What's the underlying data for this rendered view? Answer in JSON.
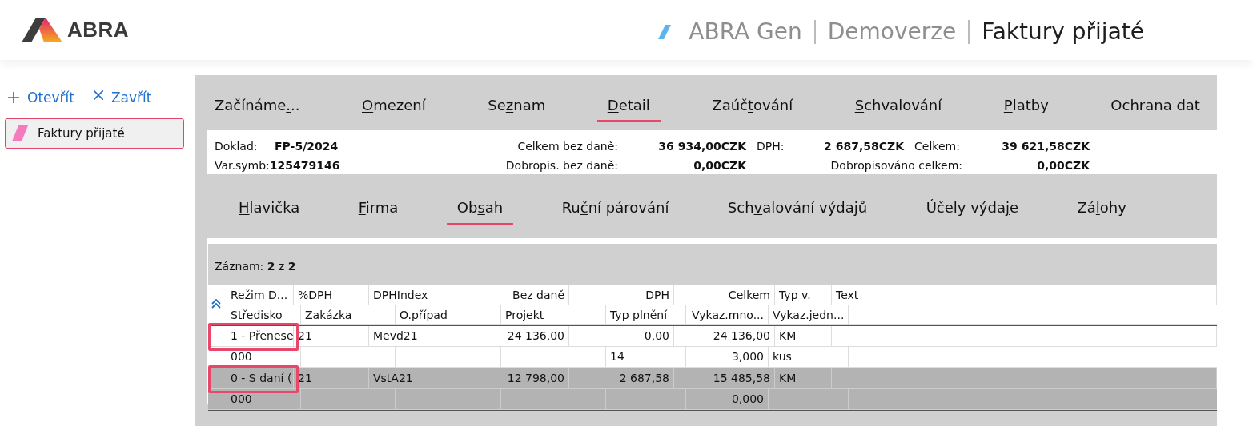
{
  "header": {
    "logo_text": "ABRA",
    "breadcrumb": [
      "ABRA Gen",
      "Demoverze",
      "Faktury přijaté"
    ]
  },
  "sidebar": {
    "actions": [
      {
        "kind": "open",
        "label": "Otevřít"
      },
      {
        "kind": "close",
        "label": "Zavřít"
      }
    ],
    "items": [
      {
        "label": "Faktury přijaté",
        "selected": true
      }
    ]
  },
  "tabs": [
    {
      "label": {
        "before": "Začínáme",
        "key": ".",
        "after": ".."
      },
      "selected": false
    },
    {
      "label": {
        "key": "O",
        "after": "mezení"
      },
      "selected": false
    },
    {
      "label": {
        "before": "Se",
        "key": "z",
        "after": "nam"
      },
      "selected": false
    },
    {
      "label": {
        "key": "D",
        "after": "etail"
      },
      "selected": true
    },
    {
      "label": {
        "before": "Zaúč",
        "key": "t",
        "after": "ování"
      },
      "selected": false
    },
    {
      "label": {
        "key": "S",
        "after": "chvalování"
      },
      "selected": false
    },
    {
      "label": {
        "key": "P",
        "after": "latby"
      },
      "selected": false
    },
    {
      "label": {
        "before": "Ochrana dat"
      },
      "selected": false
    }
  ],
  "summary": [
    {
      "label": "Doklad:",
      "value": "FP-5/2024"
    },
    {
      "label": "Celkem bez daně:",
      "value": "36 934,00CZK"
    },
    {
      "label": "DPH:",
      "value": "2 687,58CZK"
    },
    {
      "label": "Celkem:",
      "value": "39 621,58CZK"
    },
    {
      "label": "Var.symb:",
      "value": "125479146"
    },
    {
      "label": "Dobropis. bez daně:",
      "value": "0,00CZK"
    },
    {
      "label": "Dobropisováno celkem:",
      "value": "0,00CZK"
    }
  ],
  "subtabs": [
    {
      "label": {
        "key": "H",
        "after": "lavička"
      },
      "selected": false
    },
    {
      "label": {
        "key": "F",
        "after": "irma"
      },
      "selected": false
    },
    {
      "label": {
        "before": "Ob",
        "key": "s",
        "after": "ah"
      },
      "selected": true
    },
    {
      "label": {
        "before": "Ru",
        "key": "č",
        "after": "ní párování"
      },
      "selected": false
    },
    {
      "label": {
        "before": "Sch",
        "key": "v",
        "after": "alování výdajů"
      },
      "selected": false
    },
    {
      "label": {
        "before": "Účely výda",
        "key": "j",
        "after": "e"
      },
      "selected": false
    },
    {
      "label": {
        "before": "Zá",
        "key": "l",
        "after": "ohy"
      },
      "selected": false
    }
  ],
  "record_bar": "Záznam: **2** z **2**",
  "table": {
    "header_lines": [
      [
        "Režim D...",
        "%DPH",
        "DPHIndex",
        "Bez daně",
        "DPH",
        "Celkem",
        "Typ v.",
        "Text"
      ],
      [
        "Středisko",
        "Zakázka",
        "O.případ",
        "Projekt",
        "Typ plnění",
        "Vykaz.mno...",
        "Vykaz.jedn..."
      ]
    ],
    "rows": [
      {
        "selected": false,
        "highlighted": true,
        "lines": [
          {
            "rezim_d": "1 - Přenese",
            "dph_pct": "21",
            "dph_index": "Mevd21",
            "bez_dane": "24 136,00",
            "dph": "0,00",
            "celkem": "24 136,00",
            "typ_v": "KM"
          },
          {
            "stredisko": "000",
            "typ_plneni": "14",
            "vykaz_mno": "3,000",
            "vykaz_jedn": "kus"
          }
        ]
      },
      {
        "selected": true,
        "highlighted": true,
        "lines": [
          {
            "rezim_d": "0 - S daní (",
            "dph_pct": "21",
            "dph_index": "VstA21",
            "bez_dane": "12 798,00",
            "dph": "2 687,58",
            "celkem": "15 485,58",
            "typ_v": "KM"
          },
          {
            "stredisko": "000",
            "vykaz_mno": "0,000"
          }
        ]
      }
    ]
  }
}
